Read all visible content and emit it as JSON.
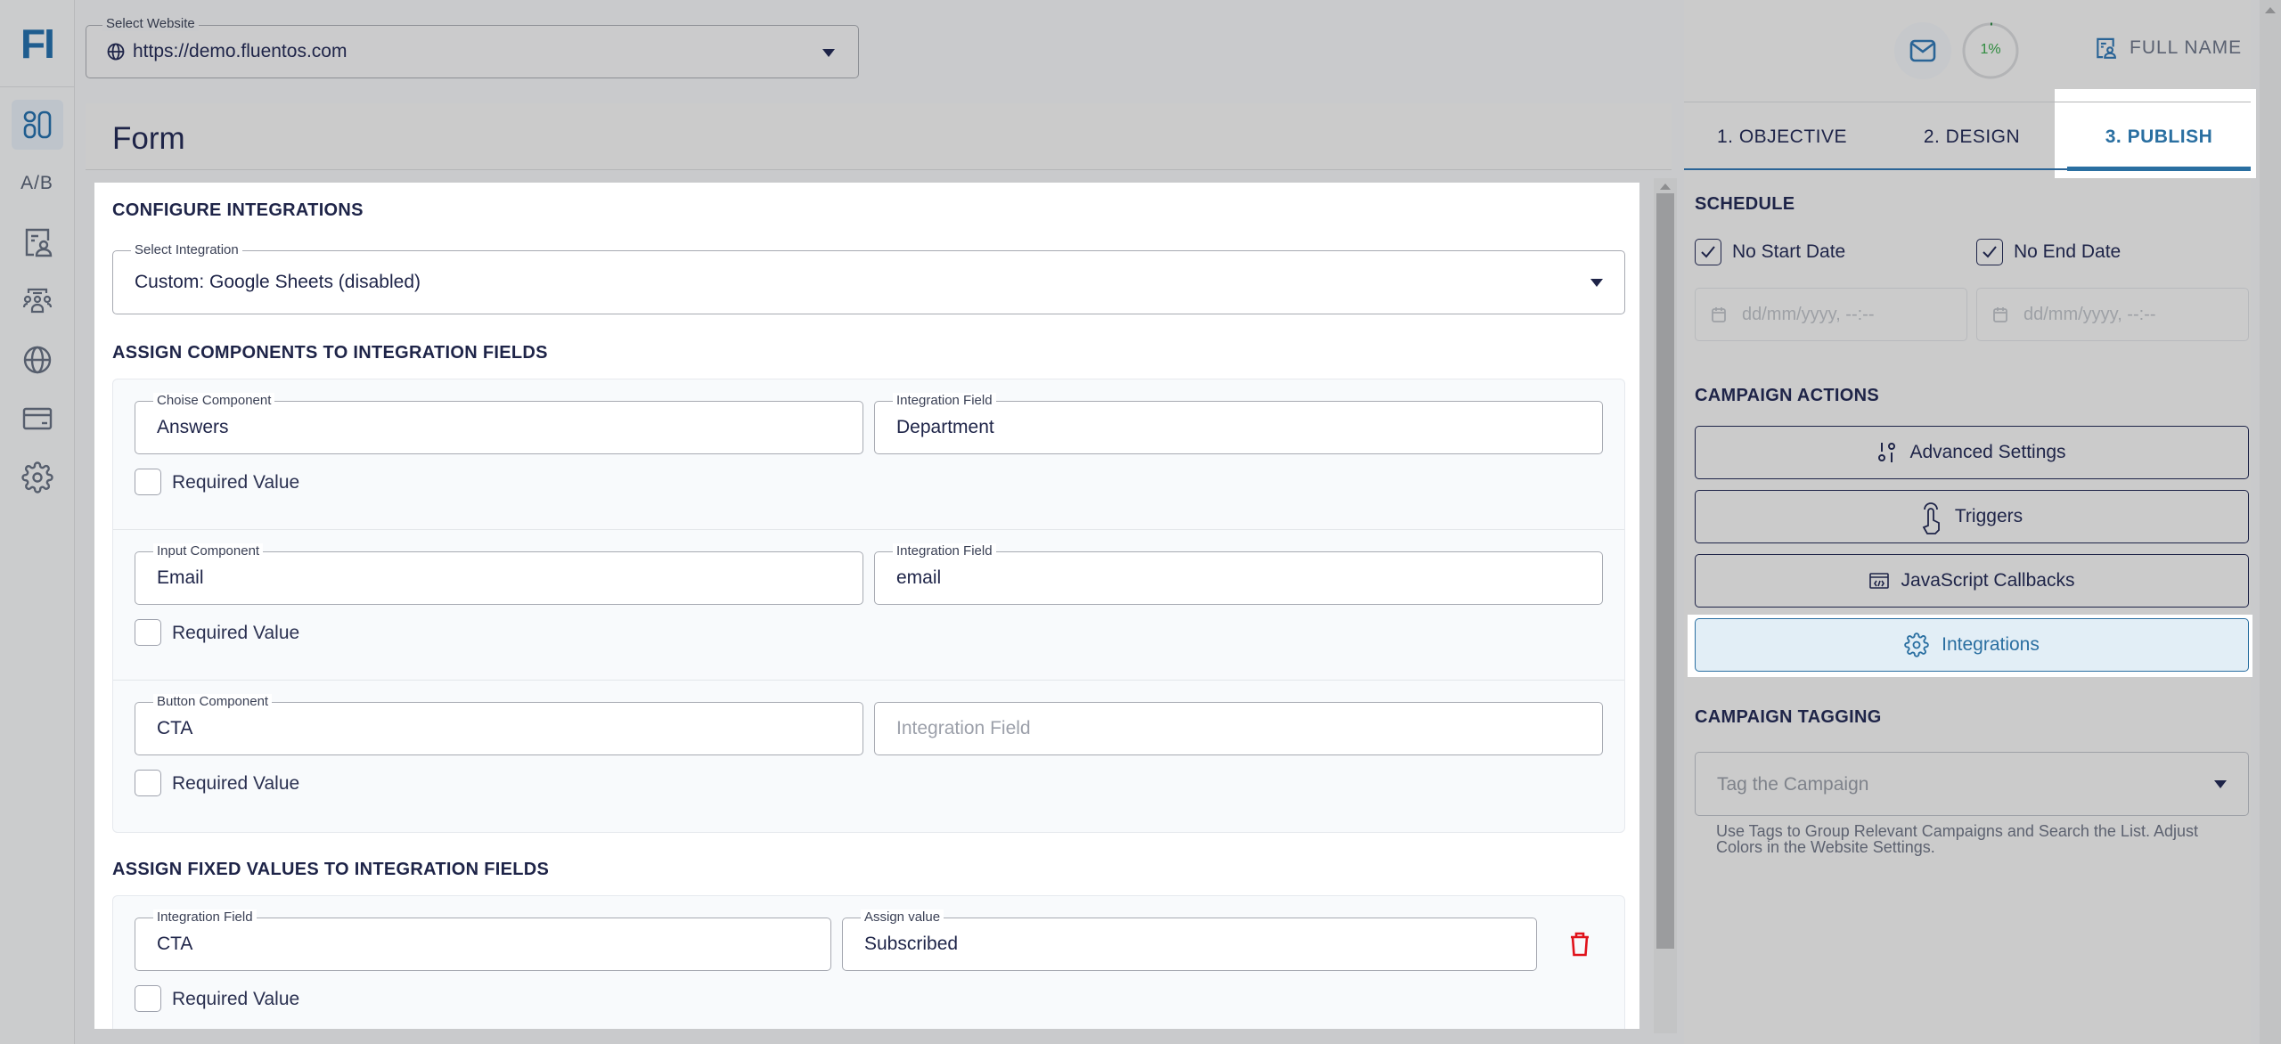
{
  "logo": "FI",
  "rail": {
    "items": [
      {
        "name": "campaigns",
        "icon": "grid-icon",
        "active": true
      },
      {
        "name": "ab-testing",
        "label": "A/B"
      },
      {
        "name": "contacts",
        "icon": "contact-card-icon"
      },
      {
        "name": "audiences",
        "icon": "users-group-icon"
      },
      {
        "name": "websites",
        "icon": "globe-icon"
      },
      {
        "name": "billing",
        "icon": "credit-card-icon"
      },
      {
        "name": "settings",
        "icon": "gear-icon"
      }
    ]
  },
  "website_select": {
    "label": "Select Website",
    "value": "https://demo.fluentos.com"
  },
  "page_title": "Form",
  "configure": {
    "title": "CONFIGURE INTEGRATIONS",
    "integration_label": "Select Integration",
    "integration_value": "Custom: Google Sheets (disabled)"
  },
  "assign_components": {
    "title": "ASSIGN COMPONENTS TO INTEGRATION FIELDS",
    "rows": [
      {
        "component_label": "Choise Component",
        "component_value": "Answers",
        "field_label": "Integration Field",
        "field_value": "Department",
        "field_placeholder": "",
        "required_label": "Required Value",
        "required": false
      },
      {
        "component_label": "Input Component",
        "component_value": "Email",
        "field_label": "Integration Field",
        "field_value": "email",
        "field_placeholder": "",
        "required_label": "Required Value",
        "required": false
      },
      {
        "component_label": "Button Component",
        "component_value": "CTA",
        "field_label": "",
        "field_value": "",
        "field_placeholder": "Integration Field",
        "required_label": "Required Value",
        "required": false
      }
    ]
  },
  "assign_fixed": {
    "title": "ASSIGN FIXED VALUES TO INTEGRATION FIELDS",
    "rows": [
      {
        "field_label": "Integration Field",
        "field_value": "CTA",
        "value_label": "Assign value",
        "value": "Subscribed",
        "required_label": "Required Value",
        "required": false
      }
    ]
  },
  "header": {
    "progress_percent": 1,
    "progress_label": "1%",
    "user_name": "FULL NAME"
  },
  "tabs": [
    {
      "label": "1. OBJECTIVE",
      "active": false
    },
    {
      "label": "2. DESIGN",
      "active": false
    },
    {
      "label": "3. PUBLISH",
      "active": true
    }
  ],
  "schedule": {
    "title": "SCHEDULE",
    "no_start_label": "No Start Date",
    "no_start_checked": true,
    "no_end_label": "No End Date",
    "no_end_checked": true,
    "start_placeholder": "dd/mm/yyyy, --:--",
    "end_placeholder": "dd/mm/yyyy, --:--"
  },
  "campaign_actions": {
    "title": "CAMPAIGN ACTIONS",
    "buttons": [
      {
        "label": "Advanced Settings",
        "icon": "sliders-icon"
      },
      {
        "label": "Triggers",
        "icon": "pointer-hand-icon"
      },
      {
        "label": "JavaScript Callbacks",
        "icon": "code-window-icon"
      },
      {
        "label": "Integrations",
        "icon": "gear-icon",
        "active": true
      }
    ]
  },
  "campaign_tagging": {
    "title": "CAMPAIGN TAGGING",
    "placeholder": "Tag the Campaign",
    "hint": "Use Tags to Group Relevant Campaigns and Search the List. Adjust Colors in the Website Settings."
  },
  "colors": {
    "brand": "#1f5d8f",
    "accent": "#2a6fa1",
    "text": "#1e2448",
    "danger": "#e0121b",
    "progress": "#2e8b3e"
  }
}
